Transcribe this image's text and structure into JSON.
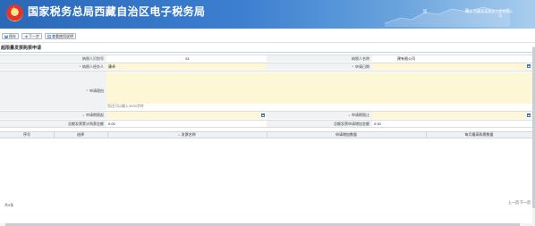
{
  "header": {
    "title": "国家税务总局西藏自治区电子税务局",
    "user_line1": "欢迎 西藏某某建设工程有限公",
    "user_line2": "司"
  },
  "toolbar": {
    "save_label": "保存",
    "next_label": "下一步",
    "history_label": "查看使用说明"
  },
  "form": {
    "section_title": "超限量发票购票申请",
    "taxpayer_id_label": "纳税人识别号",
    "taxpayer_id_value": "91",
    "taxpayer_name_label": "纳税人名称",
    "taxpayer_name_value": "建有限公司",
    "handler_label": "纳税人经办人",
    "handler_value": "康卓",
    "apply_date_label": "申请日期",
    "apply_date_value": "",
    "reason_label": "申请理由",
    "reason_value": "",
    "reason_hint": "您还可以输入3000字符",
    "period_start_label": "申请期限起",
    "period_start_value": "",
    "period_end_label": "申请期限止",
    "period_end_value": "",
    "total_amount_label": "总额发票累计购票金额",
    "total_amount_value": "0.00",
    "total_apply_label": "总额发票申请增加金额",
    "total_apply_value": "0.00"
  },
  "grid": {
    "columns": [
      "序号",
      "选择",
      "发票名称",
      "申请增加数量",
      "每月最高购票数量"
    ]
  },
  "pager": {
    "empty_text": "共0条",
    "prev_label": "上一页",
    "next_label": "下一页"
  },
  "colors": {
    "banner": "#2f6fc4",
    "required_input": "#fdf7d6",
    "label_bg": "#f1f2f4",
    "accent": "#3a7bd5"
  }
}
